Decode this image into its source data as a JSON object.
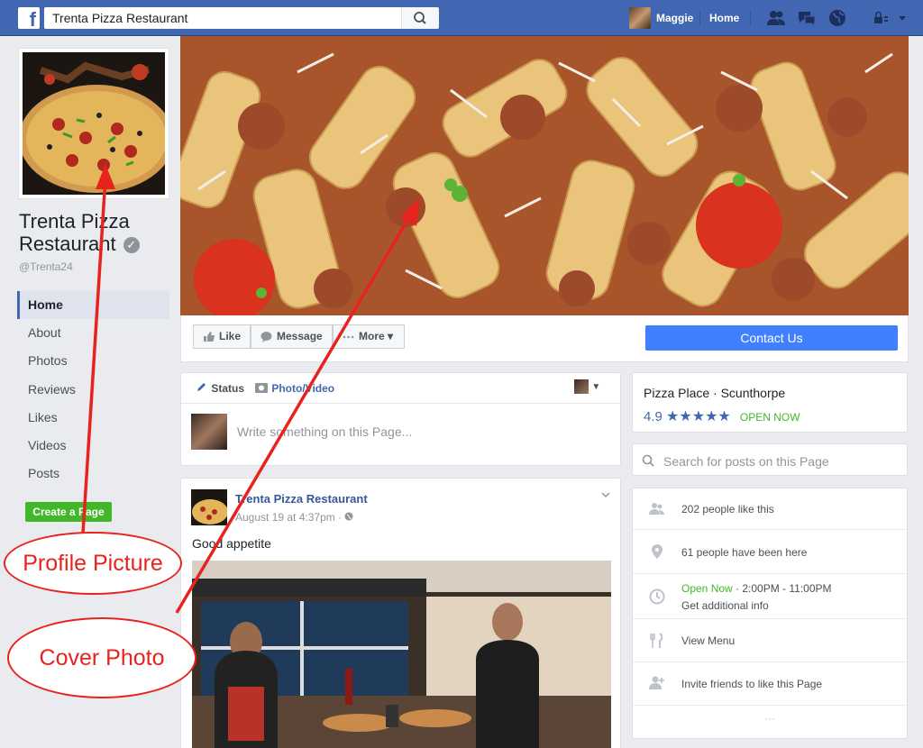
{
  "topbar": {
    "logo": "f",
    "search_value": "Trenta Pizza Restaurant",
    "user_name": "Maggie",
    "home_label": "Home",
    "icons": [
      "friend-requests-icon",
      "messages-icon",
      "notifications-globe-icon",
      "privacy-lock-icon",
      "account-dropdown-icon"
    ]
  },
  "page": {
    "name": "Trenta Pizza Restaurant",
    "handle": "@Trenta24",
    "create_page_label": "Create a Page"
  },
  "leftnav": {
    "items": [
      {
        "label": "Home"
      },
      {
        "label": "About"
      },
      {
        "label": "Photos"
      },
      {
        "label": "Reviews"
      },
      {
        "label": "Likes"
      },
      {
        "label": "Videos"
      },
      {
        "label": "Posts"
      }
    ]
  },
  "actions": {
    "like": "Like",
    "message": "Message",
    "more": "More",
    "contact": "Contact Us"
  },
  "composer": {
    "tab_status": "Status",
    "tab_photo": "Photo/Video",
    "placeholder": "Write something on this Page..."
  },
  "post": {
    "author": "Trenta Pizza Restaurant",
    "time": "August 19 at 4:37pm · ",
    "text": "Good appetite"
  },
  "place": {
    "name": "Pizza Place · Scunthorpe",
    "rating": "4.9",
    "stars": "★★★★★",
    "open": "OPEN NOW"
  },
  "search_posts": {
    "placeholder": "Search for posts on this Page"
  },
  "about": {
    "likes": "202 people like this",
    "visits": "61 people have been here",
    "open_now": "Open Now",
    "hours": " · 2:00PM - 11:00PM",
    "additional": "Get additional info",
    "menu": "View Menu",
    "invite": "Invite friends to like this Page",
    "more": "···"
  },
  "annotations": {
    "profile_label": "Profile Picture",
    "cover_label": "Cover Photo",
    "color": "#e8231f"
  }
}
